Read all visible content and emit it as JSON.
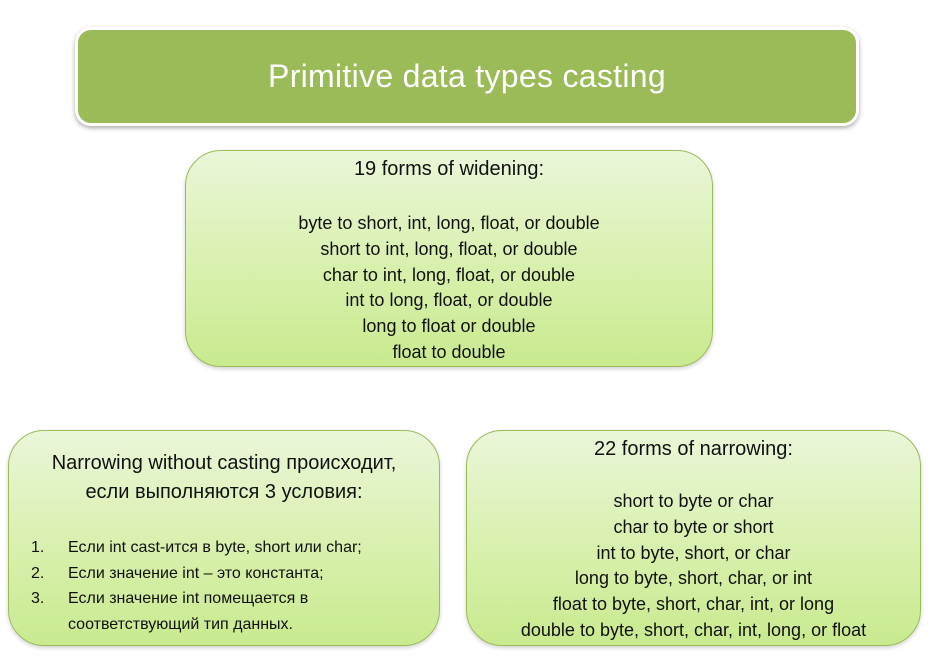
{
  "title": "Primitive data types casting",
  "widening": {
    "heading": "19 forms of widening:",
    "lines": [
      "byte to short, int, long, float, or double",
      "short to int, long, float, or double",
      "char to int, long, float, or double",
      "int to long, float, or double",
      "long to float or double",
      "float to double"
    ]
  },
  "narrowing_conditions": {
    "heading_line1": "Narrowing without casting происходит,",
    "heading_line2": "если выполняются 3 условия:",
    "items": [
      {
        "num": "1.",
        "text": "Если int cast-ится в byte, short или char;"
      },
      {
        "num": "2.",
        "text": "Если значение  int – это константа;"
      },
      {
        "num": "3.",
        "text": "Если значение  int помещается в"
      },
      {
        "num": "",
        "text": "соответствующий  тип данных."
      }
    ]
  },
  "narrowing": {
    "heading": "22 forms of narrowing:",
    "lines": [
      "short to byte or char",
      "char to byte or short",
      "int to byte, short, or char",
      "long to byte, short, char, or int",
      "float to byte, short, char, int, or long",
      "double to byte, short, char, int, long, or float"
    ]
  }
}
